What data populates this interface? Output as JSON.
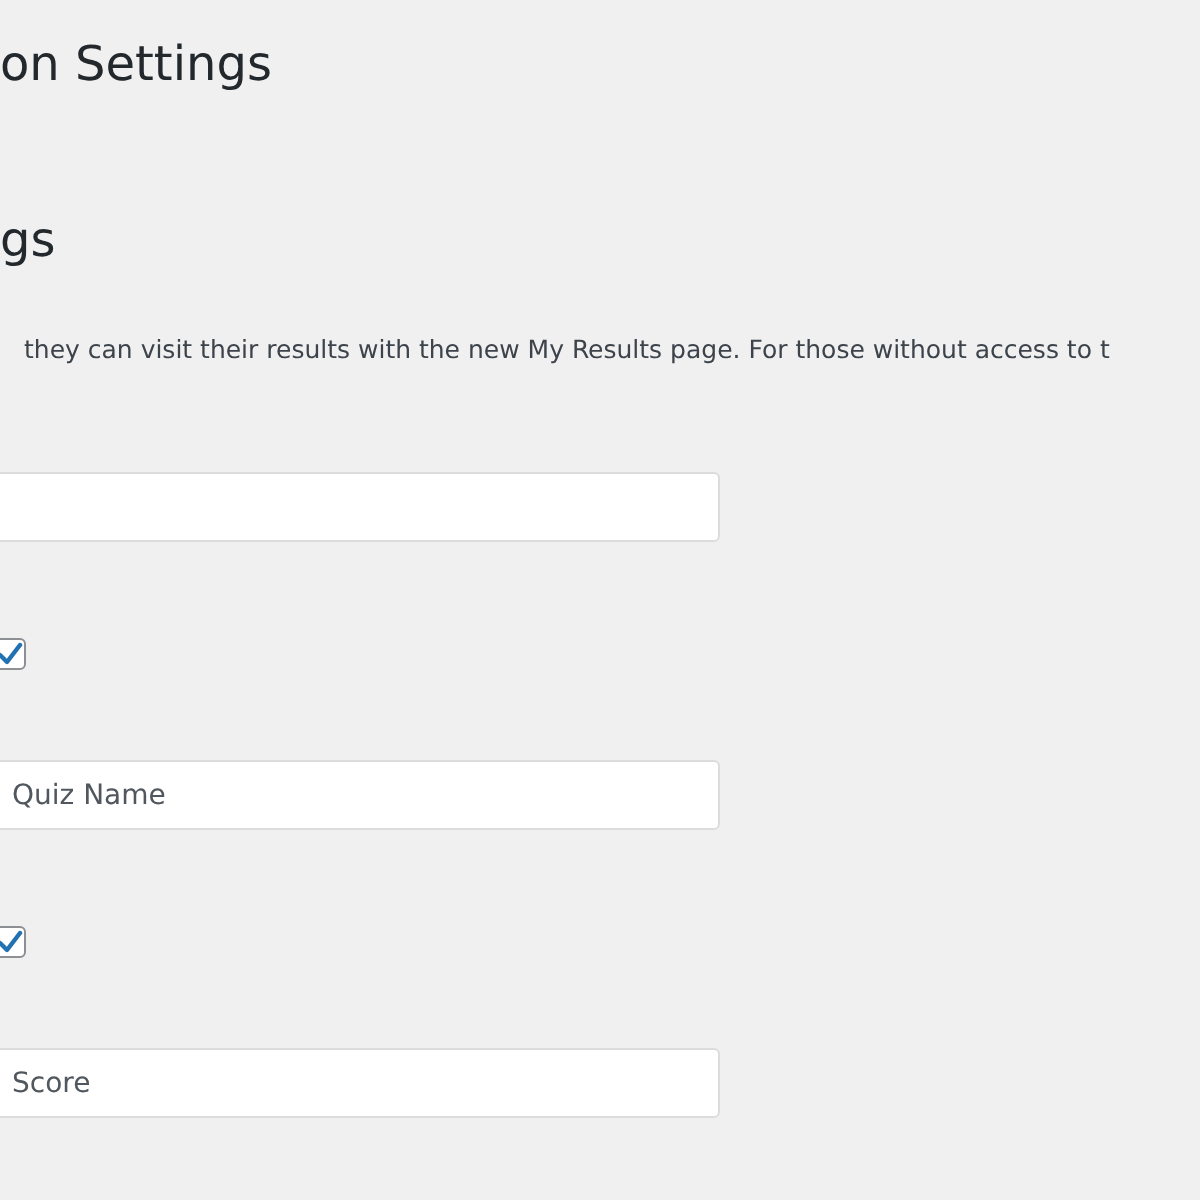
{
  "page_title": "on Settings",
  "section_title": "gs",
  "description": "they can visit their results with the new My Results page. For those without access to t",
  "items": [
    {
      "kind": "field"
    },
    {
      "kind": "checkbox",
      "checked": true
    },
    {
      "kind": "field",
      "value": "Quiz Name"
    },
    {
      "kind": "checkbox",
      "checked": true
    },
    {
      "kind": "field",
      "value": "Score"
    }
  ]
}
